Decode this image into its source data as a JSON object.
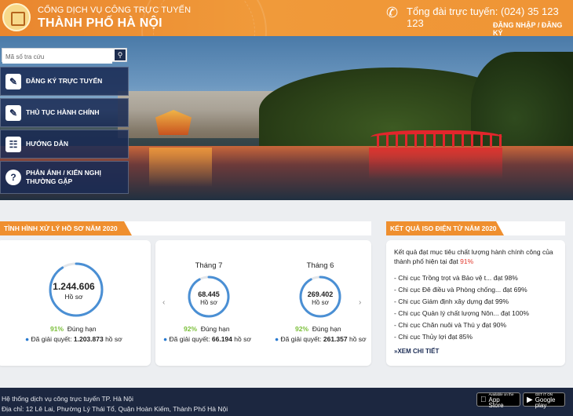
{
  "header": {
    "brand_line1": "CỔNG DỊCH VỤ CÔNG TRỰC TUYẾN",
    "brand_line2": "THÀNH PHỐ HÀ NỘI",
    "hotline": "Tổng đài trực tuyến: (024) 35 123 123",
    "login": "ĐĂNG NHẬP / ĐĂNG KÝ",
    "icons": {
      "logo": "hanoi-emblem",
      "phone": "phone-icon"
    }
  },
  "search": {
    "placeholder": "Mã số tra cứu",
    "icon": "search-icon"
  },
  "menu": [
    {
      "label": "ĐĂNG KÝ TRỰC TUYẾN",
      "icon": "edit-icon"
    },
    {
      "label": "THỦ TỤC HÀNH CHÍNH",
      "icon": "document-icon"
    },
    {
      "label": "HƯỚNG DẪN",
      "icon": "guide-icon"
    },
    {
      "label": "PHẢN ÁNH / KIẾN NGHỊ THƯỜNG GẶP",
      "icon": "question-icon"
    }
  ],
  "status_section": {
    "title": "TÌNH HÌNH XỬ LÝ HỒ SƠ NĂM 2020",
    "year_total": {
      "value": "1.244.606",
      "unit": "Hồ sơ",
      "ontime_pct": "91%",
      "ontime_label": "Đúng hạn",
      "resolved_label": "Đã giải quyết:",
      "resolved_value": "1.203.873",
      "resolved_unit": "hồ sơ",
      "fill": 0.91
    },
    "months": [
      {
        "month": "Tháng 7",
        "value": "68.445",
        "unit": "Hồ sơ",
        "ontime_pct": "92%",
        "ontime_label": "Đúng hạn",
        "resolved_label": "Đã giải quyết:",
        "resolved_value": "66.194",
        "resolved_unit": "hồ sơ",
        "fill": 0.92
      },
      {
        "month": "Tháng 6",
        "value": "269.402",
        "unit": "Hồ sơ",
        "ontime_pct": "92%",
        "ontime_label": "Đúng hạn",
        "resolved_label": "Đã giải quyết:",
        "resolved_value": "261.357",
        "resolved_unit": "hồ sơ",
        "fill": 0.92
      }
    ]
  },
  "iso_section": {
    "title": "KẾT QUẢ ISO ĐIỆN TỬ NĂM 2020",
    "intro": "Kết quả đạt mục tiêu chất lượng hành chính công của thành phố hiện tại đạt",
    "intro_pct": "91%",
    "items": [
      "- Chi cục Trồng trọt và Bảo vệ t... đạt 98%",
      "- Chi cục Đê điều và Phòng chống... đạt 69%",
      "- Chi cục Giám định xây dựng đạt 99%",
      "- Chi cục Quản lý chất lượng Nôn... đạt 100%",
      "- Chi cục Chăn nuôi và Thú y đạt 90%",
      "- Chi cục Thủy lợi đạt 85%"
    ],
    "more": "XEM CHI TIẾT"
  },
  "footer": {
    "line1": "Hệ thống dịch vụ công trực tuyến TP. Hà Nội",
    "line2": "Địa chỉ: 12 Lê Lai, Phường Lý Thái Tổ, Quận Hoàn Kiếm, Thành Phố Hà Nội",
    "appstore_small": "Available on the",
    "appstore_big": "App Store",
    "googleplay_small": "GET IT ON",
    "googleplay_big": "Google play"
  },
  "colors": {
    "accent": "#ef8f2f",
    "navy": "#1a2b54",
    "ring": "#4a8fd4",
    "green": "#7bbf3a",
    "red": "#e23b2f"
  }
}
